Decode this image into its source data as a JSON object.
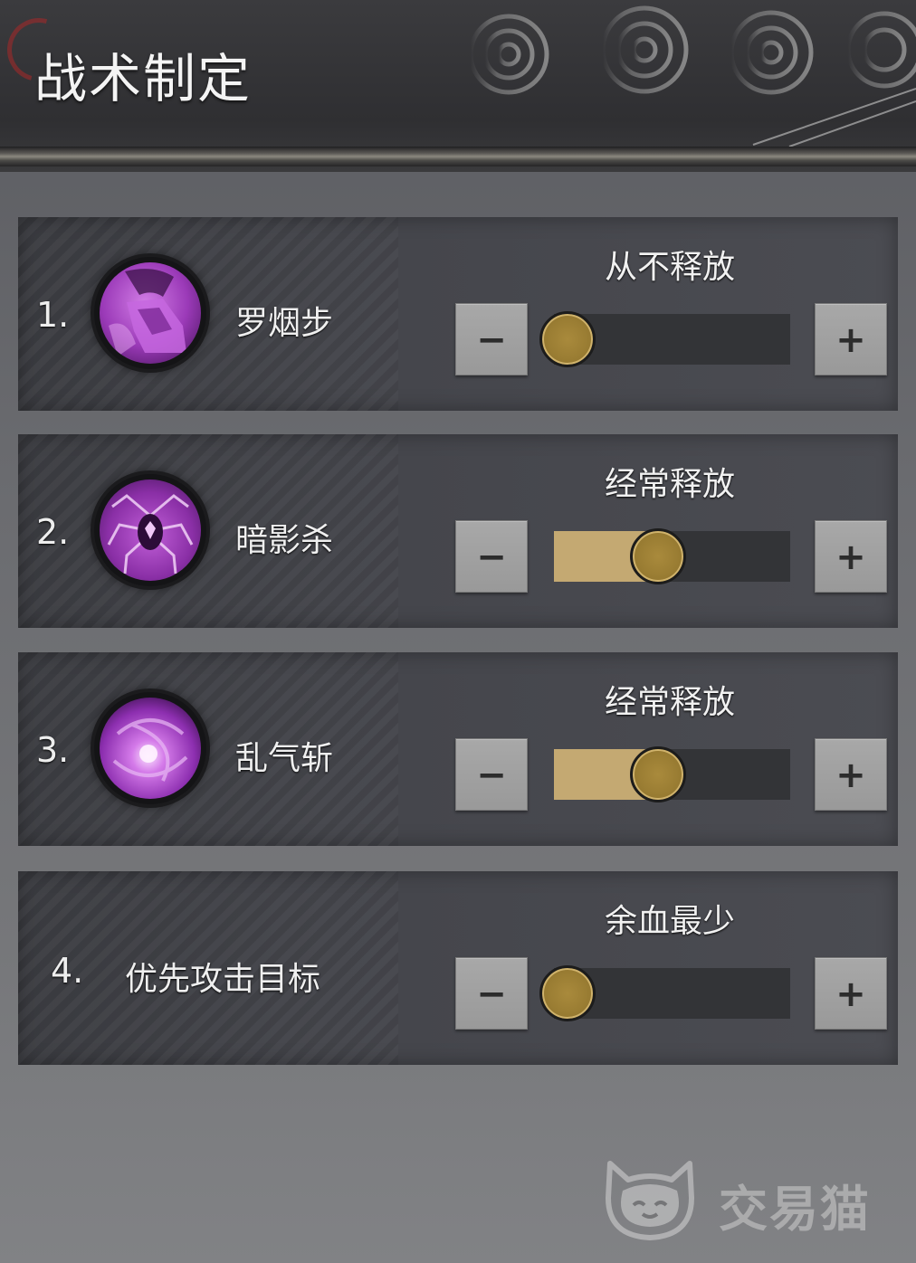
{
  "header": {
    "title": "战术制定"
  },
  "rows": [
    {
      "number": "1.",
      "skill_name": "罗烟步",
      "icon": "purple-boot-skill-icon",
      "mode_label": "从不释放",
      "slider_value": 0.0,
      "minus_label": "−",
      "plus_label": "+"
    },
    {
      "number": "2.",
      "skill_name": "暗影杀",
      "icon": "purple-spider-skill-icon",
      "mode_label": "经常释放",
      "slider_value": 0.5,
      "minus_label": "−",
      "plus_label": "+"
    },
    {
      "number": "3.",
      "skill_name": "乱气斩",
      "icon": "purple-vortex-skill-icon",
      "mode_label": "经常释放",
      "slider_value": 0.5,
      "minus_label": "−",
      "plus_label": "+"
    },
    {
      "number": "4.",
      "target_label": "优先攻击目标",
      "mode_label": "余血最少",
      "slider_value": 0.0,
      "minus_label": "−",
      "plus_label": "+"
    }
  ],
  "watermark": {
    "text": "交易猫",
    "icon": "cat-logo-icon"
  },
  "colors": {
    "slider_fill": "#c4a972",
    "slider_knob": "#9a7d33",
    "skill_purple": "#a43fbf",
    "panel": "#44454b"
  }
}
